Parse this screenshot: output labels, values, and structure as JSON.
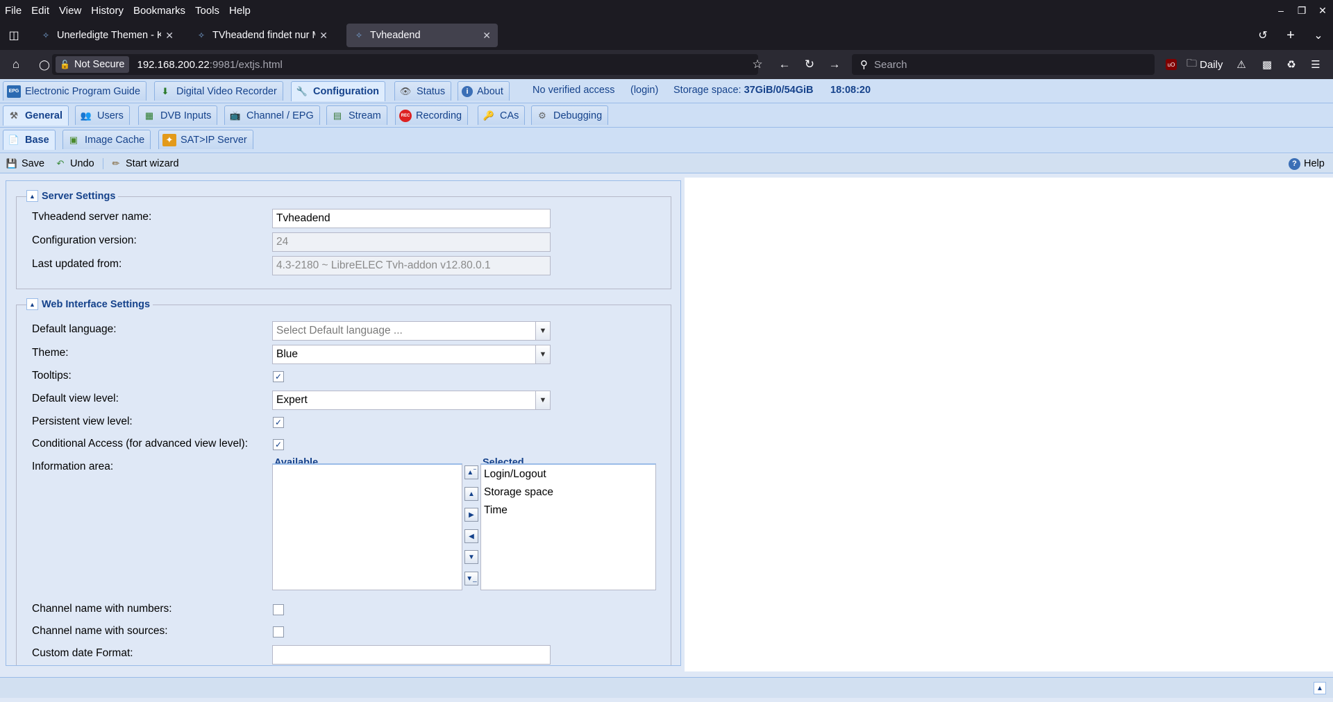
{
  "browser": {
    "menu": [
      "File",
      "Edit",
      "View",
      "History",
      "Bookmarks",
      "Tools",
      "Help"
    ],
    "tabs": [
      {
        "label": "Unerledigte Themen - Ko",
        "active": false
      },
      {
        "label": "TVheadend findet nur Mu",
        "active": false
      },
      {
        "label": "Tvheadend",
        "active": true
      }
    ],
    "security_label": "Not Secure",
    "url_host": "192.168.200.22",
    "url_rest": ":9981/extjs.html",
    "search_placeholder": "Search",
    "bookmark_folder": "Daily"
  },
  "app": {
    "main_tabs": [
      {
        "label": "Electronic Program Guide",
        "icon": "epg-icon"
      },
      {
        "label": "Digital Video Recorder",
        "icon": "dvr-icon"
      },
      {
        "label": "Configuration",
        "icon": "wrench-icon",
        "active": true
      },
      {
        "label": "Status",
        "icon": "eye-icon"
      },
      {
        "label": "About",
        "icon": "info-icon"
      }
    ],
    "access_text": "No verified access",
    "login_text": "(login)",
    "storage_label": "Storage space:",
    "storage_value": "37GiB/0/54GiB",
    "clock": "18:08:20",
    "config_tabs": [
      {
        "label": "General",
        "active": true
      },
      {
        "label": "Users"
      },
      {
        "label": "DVB Inputs"
      },
      {
        "label": "Channel / EPG"
      },
      {
        "label": "Stream"
      },
      {
        "label": "Recording"
      },
      {
        "label": "CAs"
      },
      {
        "label": "Debugging"
      }
    ],
    "general_tabs": [
      {
        "label": "Base",
        "active": true
      },
      {
        "label": "Image Cache"
      },
      {
        "label": "SAT>IP Server"
      }
    ],
    "toolbar": {
      "save": "Save",
      "undo": "Undo",
      "wizard": "Start wizard",
      "help": "Help"
    }
  },
  "server_settings": {
    "legend": "Server Settings",
    "server_name_label": "Tvheadend server name:",
    "server_name_value": "Tvheadend",
    "config_version_label": "Configuration version:",
    "config_version_value": "24",
    "last_updated_label": "Last updated from:",
    "last_updated_value": "4.3-2180 ~ LibreELEC Tvh-addon v12.80.0.1"
  },
  "web_settings": {
    "legend": "Web Interface Settings",
    "default_language_label": "Default language:",
    "default_language_placeholder": "Select Default language ...",
    "theme_label": "Theme:",
    "theme_value": "Blue",
    "tooltips_label": "Tooltips:",
    "tooltips_checked": true,
    "view_level_label": "Default view level:",
    "view_level_value": "Expert",
    "persistent_label": "Persistent view level:",
    "persistent_checked": true,
    "conditional_label": "Conditional Access (for advanced view level):",
    "conditional_checked": true,
    "info_area_label": "Information area:",
    "available_header": "Available",
    "available_items": [],
    "selected_header": "Selected",
    "selected_items": [
      "Login/Logout",
      "Storage space",
      "Time"
    ],
    "ch_numbers_label": "Channel name with numbers:",
    "ch_numbers_checked": false,
    "ch_sources_label": "Channel name with sources:",
    "ch_sources_checked": false,
    "date_format_label": "Custom date Format:",
    "date_format_value": ""
  }
}
